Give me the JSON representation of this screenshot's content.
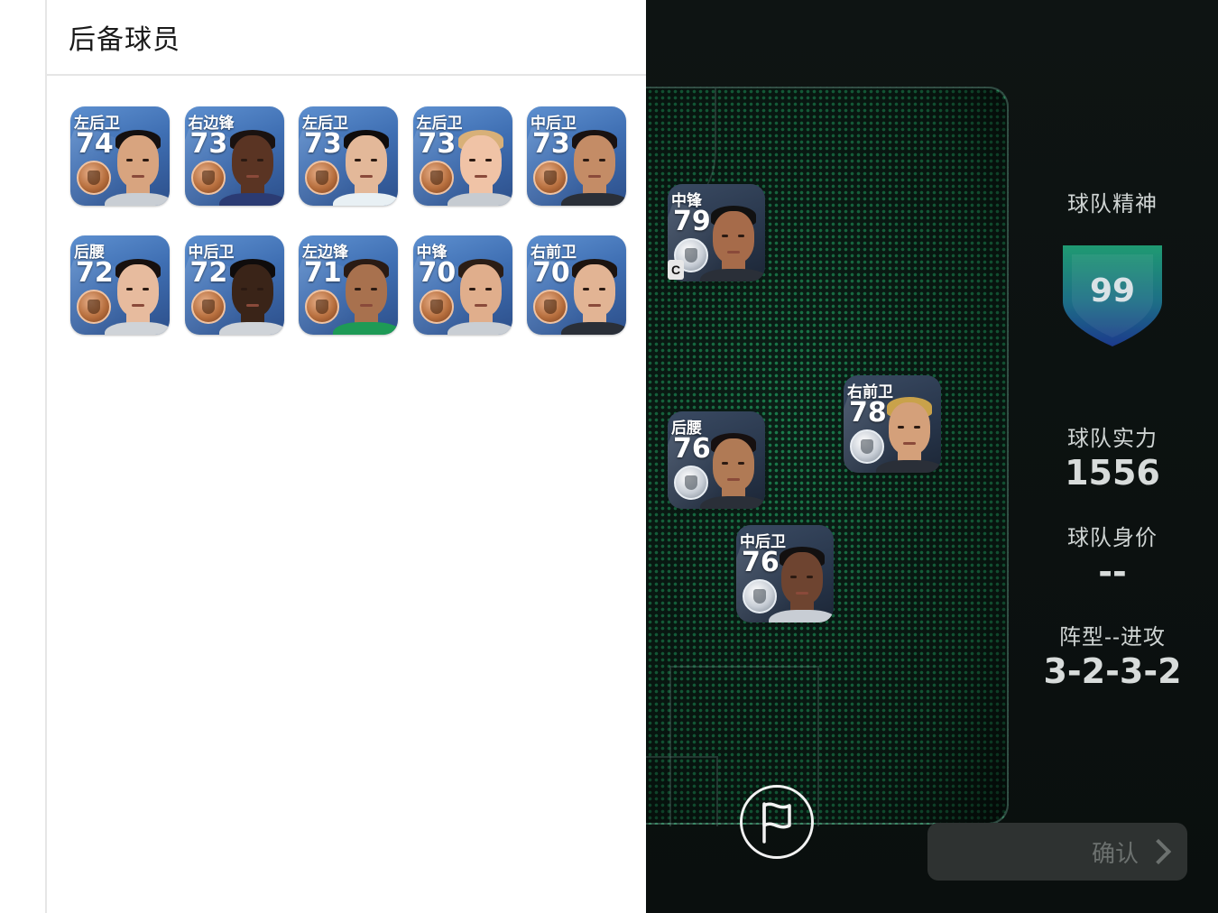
{
  "reserves_panel": {
    "title": "后备球员",
    "players": [
      {
        "position": "左后卫",
        "rating": "74",
        "medal": "bronze"
      },
      {
        "position": "右边锋",
        "rating": "73",
        "medal": "bronze"
      },
      {
        "position": "左后卫",
        "rating": "73",
        "medal": "bronze"
      },
      {
        "position": "左后卫",
        "rating": "73",
        "medal": "bronze"
      },
      {
        "position": "中后卫",
        "rating": "73",
        "medal": "bronze"
      },
      {
        "position": "后腰",
        "rating": "72",
        "medal": "bronze"
      },
      {
        "position": "中后卫",
        "rating": "72",
        "medal": "bronze"
      },
      {
        "position": "左边锋",
        "rating": "71",
        "medal": "bronze"
      },
      {
        "position": "中锋",
        "rating": "70",
        "medal": "bronze"
      },
      {
        "position": "右前卫",
        "rating": "70",
        "medal": "bronze"
      }
    ]
  },
  "pitch": {
    "players": [
      {
        "position": "中锋",
        "rating": "79",
        "captain": "C"
      },
      {
        "position": "右前卫",
        "rating": "78"
      },
      {
        "position": "后腰",
        "rating": "76"
      },
      {
        "position": "中后卫",
        "rating": "76"
      }
    ]
  },
  "team_stats": {
    "spirit_label": "球队精神",
    "spirit_value": "99",
    "strength_label": "球队实力",
    "strength_value": "1556",
    "value_label": "球队身价",
    "value_value": "--",
    "formation_label": "阵型--进攻",
    "formation_value": "3-2-3-2"
  },
  "actions": {
    "confirm_label": "确认",
    "flag_icon": "flag-icon"
  },
  "colors": {
    "pitch_dots": "#28c878",
    "shield_top": "#1f8f6e",
    "shield_bottom": "#1d3a8a",
    "bronze_medal": "#b8703f",
    "silver_medal": "#c8ced6"
  }
}
